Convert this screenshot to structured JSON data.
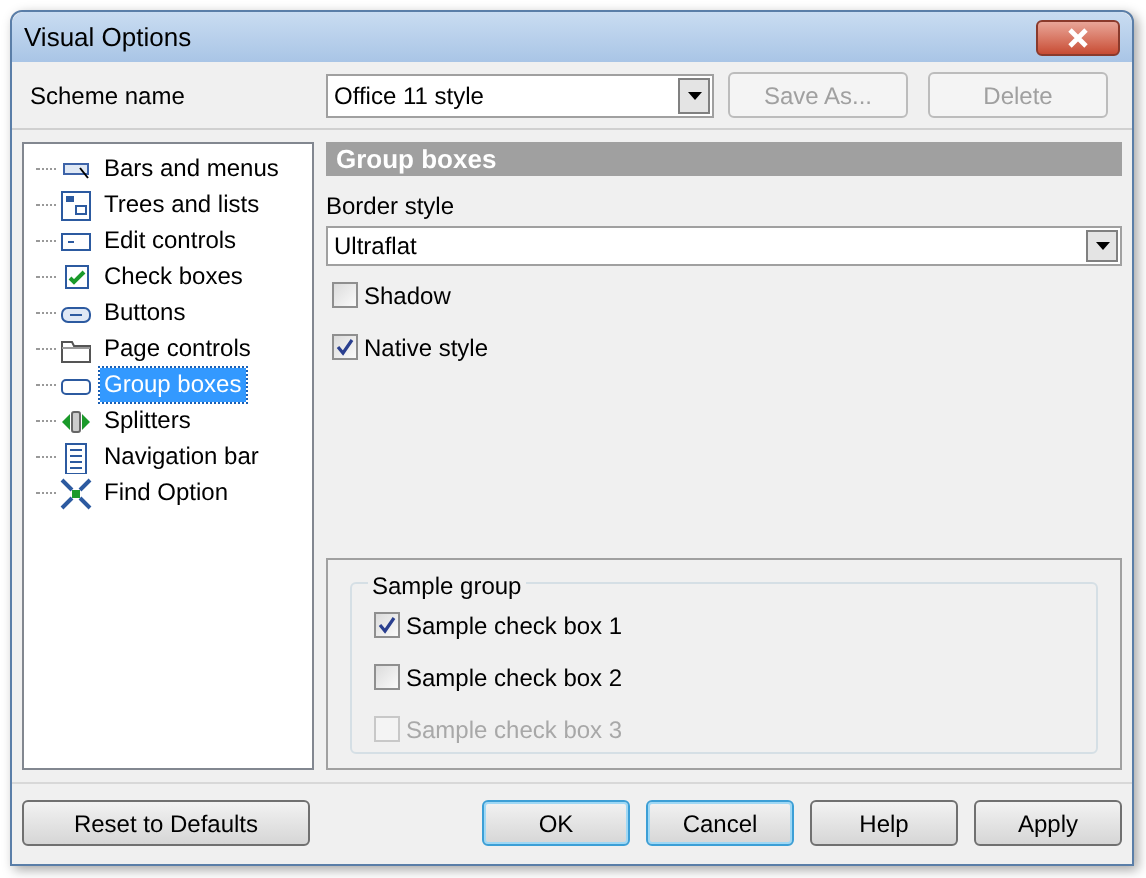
{
  "window": {
    "title": "Visual Options"
  },
  "scheme": {
    "label": "Scheme name",
    "value": "Office 11 style",
    "buttons": [
      {
        "label": "Save As...",
        "disabled": true
      },
      {
        "label": "Delete",
        "disabled": true
      }
    ]
  },
  "tree": {
    "items": [
      {
        "label": "Bars and menus",
        "kind": "bars",
        "selected": false
      },
      {
        "label": "Trees and lists",
        "kind": "tree",
        "selected": false
      },
      {
        "label": "Edit controls",
        "kind": "edit",
        "selected": false
      },
      {
        "label": "Check boxes",
        "kind": "check",
        "selected": false
      },
      {
        "label": "Buttons",
        "kind": "button",
        "selected": false
      },
      {
        "label": "Page controls",
        "kind": "folder",
        "selected": false
      },
      {
        "label": "Group boxes",
        "kind": "group",
        "selected": true
      },
      {
        "label": "Splitters",
        "kind": "splitter",
        "selected": false
      },
      {
        "label": "Navigation bar",
        "kind": "nav",
        "selected": false
      },
      {
        "label": "Find Option",
        "kind": "find",
        "selected": false
      }
    ]
  },
  "panel": {
    "title": "Group boxes",
    "border_style": {
      "label": "Border style",
      "value": "Ultraflat"
    },
    "options": [
      {
        "label": "Shadow",
        "checked": false
      },
      {
        "label": "Native style",
        "checked": true
      }
    ],
    "sample": {
      "title": "Sample group",
      "items": [
        {
          "label": "Sample check box 1",
          "checked": true,
          "disabled": false
        },
        {
          "label": "Sample check box 2",
          "checked": false,
          "disabled": false
        },
        {
          "label": "Sample check box 3",
          "checked": false,
          "disabled": true
        }
      ]
    }
  },
  "footer": {
    "reset": "Reset to Defaults",
    "buttons": [
      {
        "label": "OK",
        "default": true
      },
      {
        "label": "Cancel",
        "default": true
      },
      {
        "label": "Help",
        "default": false
      },
      {
        "label": "Apply",
        "default": false
      }
    ]
  }
}
